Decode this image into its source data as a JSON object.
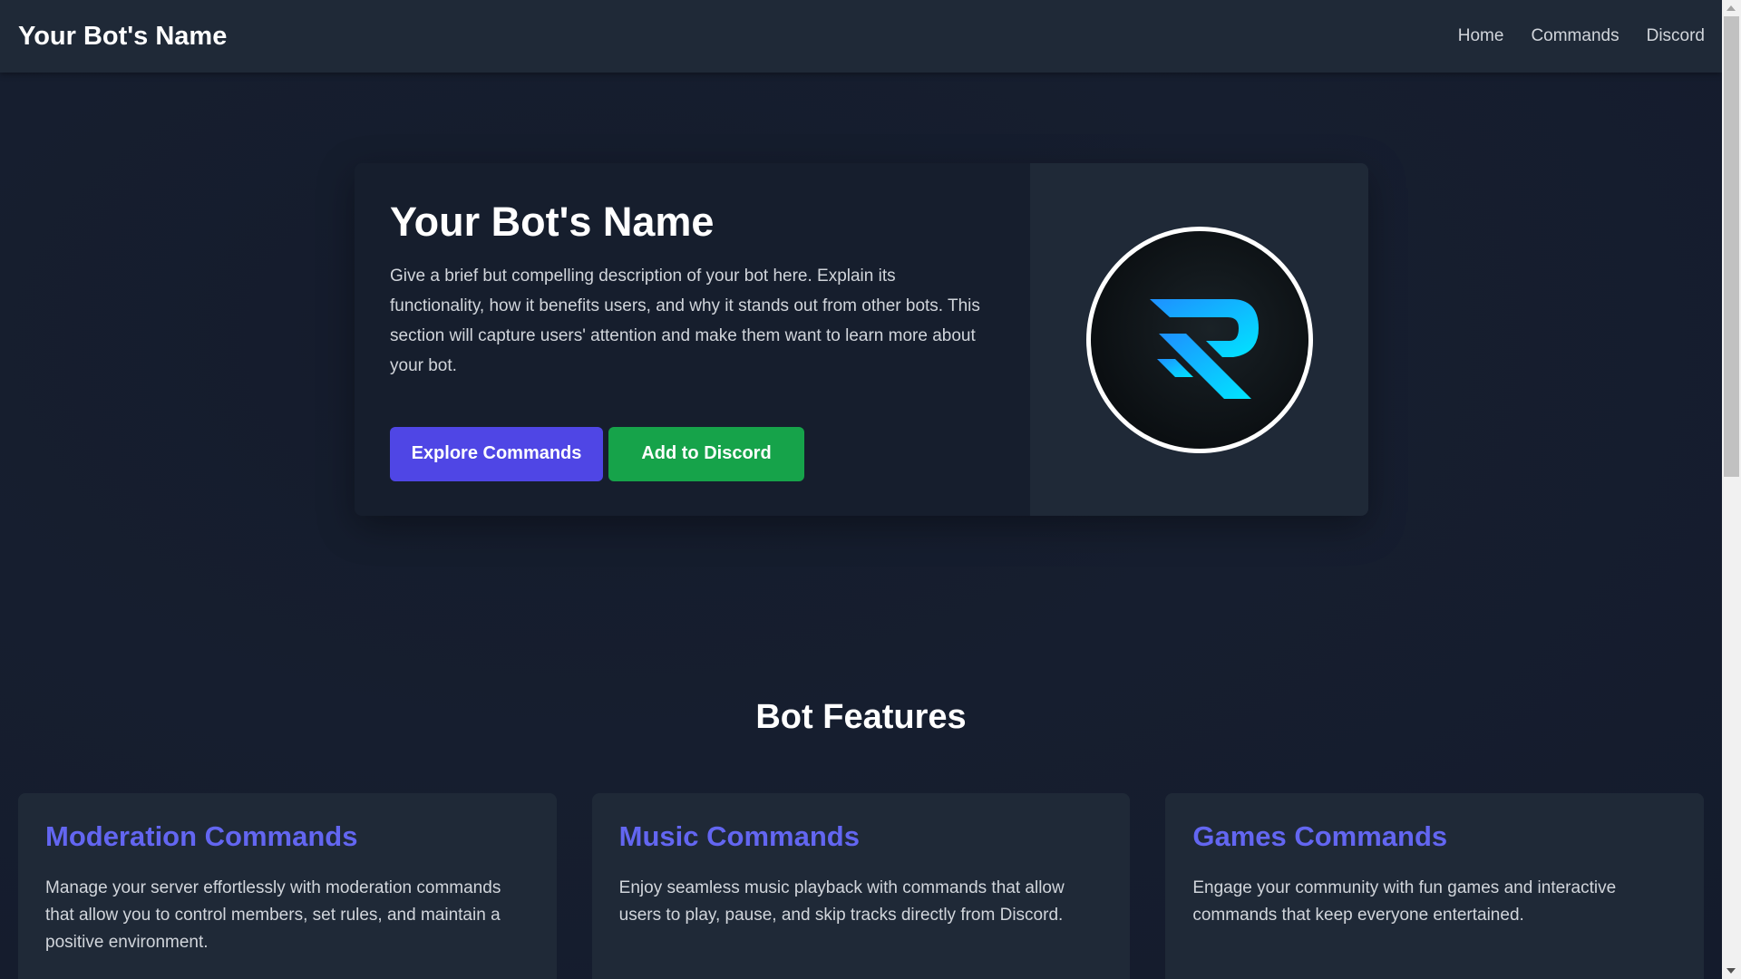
{
  "navbar": {
    "brand": "Your Bot's Name",
    "links": [
      "Home",
      "Commands",
      "Discord"
    ]
  },
  "hero": {
    "title": "Your Bot's Name",
    "description": "Give a brief but compelling description of your bot here. Explain its functionality, how it benefits users, and why it stands out from other bots. This section will capture users' attention and make them want to learn more about your bot.",
    "buttons": {
      "explore": "Explore Commands",
      "add": "Add to Discord"
    },
    "logo_icon": "bot-logo-icon"
  },
  "features": {
    "title": "Bot Features",
    "cards": [
      {
        "title": "Moderation Commands",
        "description": "Manage your server effortlessly with moderation commands that allow you to control members, set rules, and maintain a positive environment."
      },
      {
        "title": "Music Commands",
        "description": "Enjoy seamless music playback with commands that allow users to play, pause, and skip tracks directly from Discord."
      },
      {
        "title": "Games Commands",
        "description": "Engage your community with fun games and interactive commands that keep everyone entertained."
      }
    ]
  },
  "colors": {
    "accent": "#4f46e5",
    "success": "#16a34a",
    "card_title": "#6366f1",
    "navbar_bg": "#1f2937",
    "page_bg": "#161e2f"
  }
}
